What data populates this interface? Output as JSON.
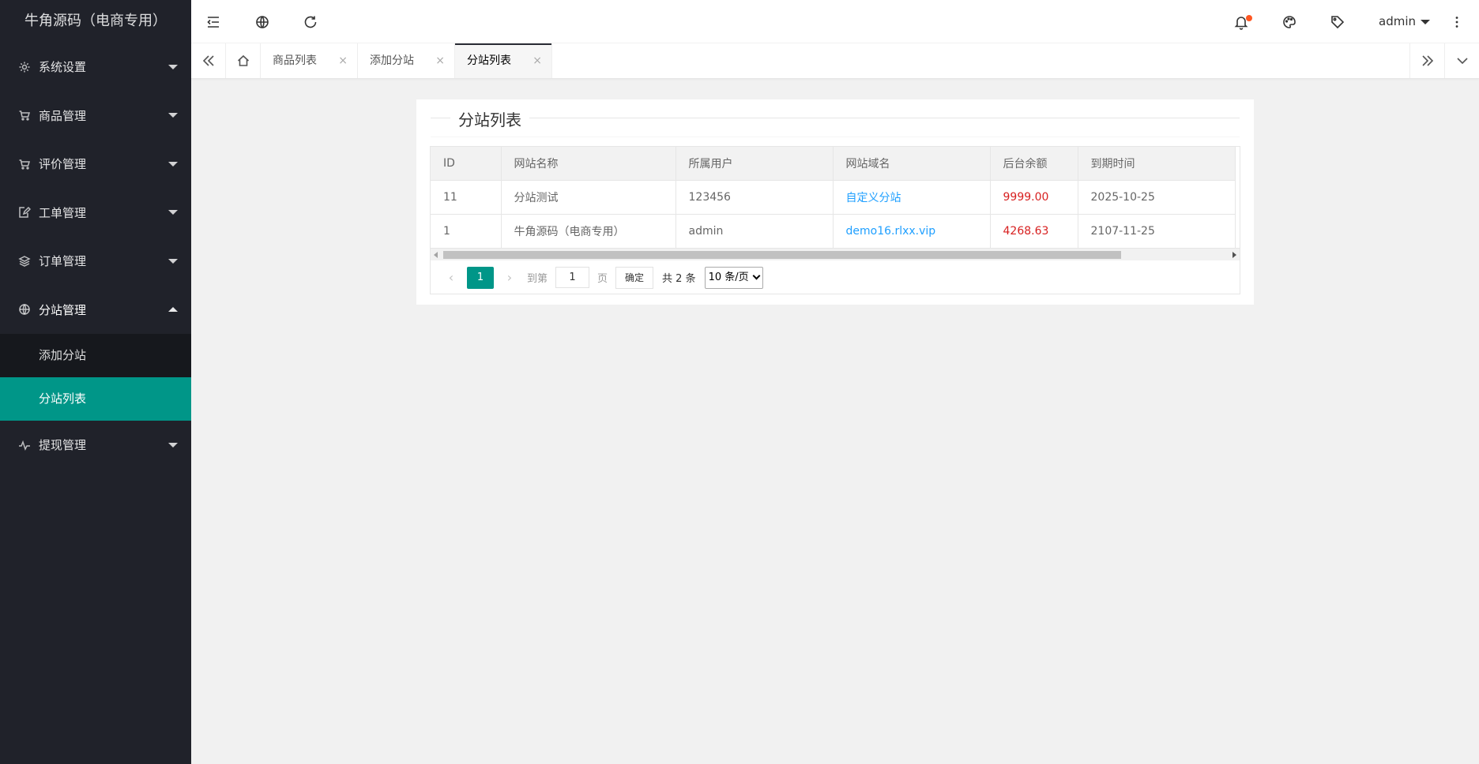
{
  "app_title": "牛角源码（电商专用）",
  "sidebar": {
    "items": [
      {
        "label": "系统设置",
        "icon": "gear-icon"
      },
      {
        "label": "商品管理",
        "icon": "cart-icon"
      },
      {
        "label": "评价管理",
        "icon": "cart-icon"
      },
      {
        "label": "工单管理",
        "icon": "edit-icon"
      },
      {
        "label": "订单管理",
        "icon": "layers-icon"
      },
      {
        "label": "分站管理",
        "icon": "globe-icon",
        "expanded": true,
        "children": [
          {
            "label": "添加分站"
          },
          {
            "label": "分站列表",
            "active": true
          }
        ]
      },
      {
        "label": "提现管理",
        "icon": "pulse-icon"
      }
    ]
  },
  "header": {
    "user": "admin",
    "notification_dot_color": "#ff5722"
  },
  "tabs": [
    {
      "label": "商品列表",
      "close": "×"
    },
    {
      "label": "添加分站",
      "close": "×"
    },
    {
      "label": "分站列表",
      "close": "×",
      "active": true
    }
  ],
  "main": {
    "title": "分站列表",
    "table": {
      "columns": [
        "ID",
        "网站名称",
        "所属用户",
        "网站域名",
        "后台余额",
        "到期时间"
      ],
      "rows": [
        [
          "11",
          "分站测试",
          "123456",
          "自定义分站",
          "9999.00",
          "2025-10-25"
        ],
        [
          "1",
          "牛角源码（电商专用）",
          "admin",
          "demo16.rlxx.vip",
          "4268.63",
          "2107-11-25"
        ]
      ]
    },
    "pager": {
      "current": "1",
      "goto_label": "到第",
      "page_value": "1",
      "page_unit": "页",
      "confirm": "确定",
      "count": "共 2 条",
      "limit": "10 条/页"
    }
  },
  "colors": {
    "accent": "#009688",
    "sidebar_bg": "#20222a",
    "link": "#1e9fff",
    "money": "#d71f1f"
  }
}
